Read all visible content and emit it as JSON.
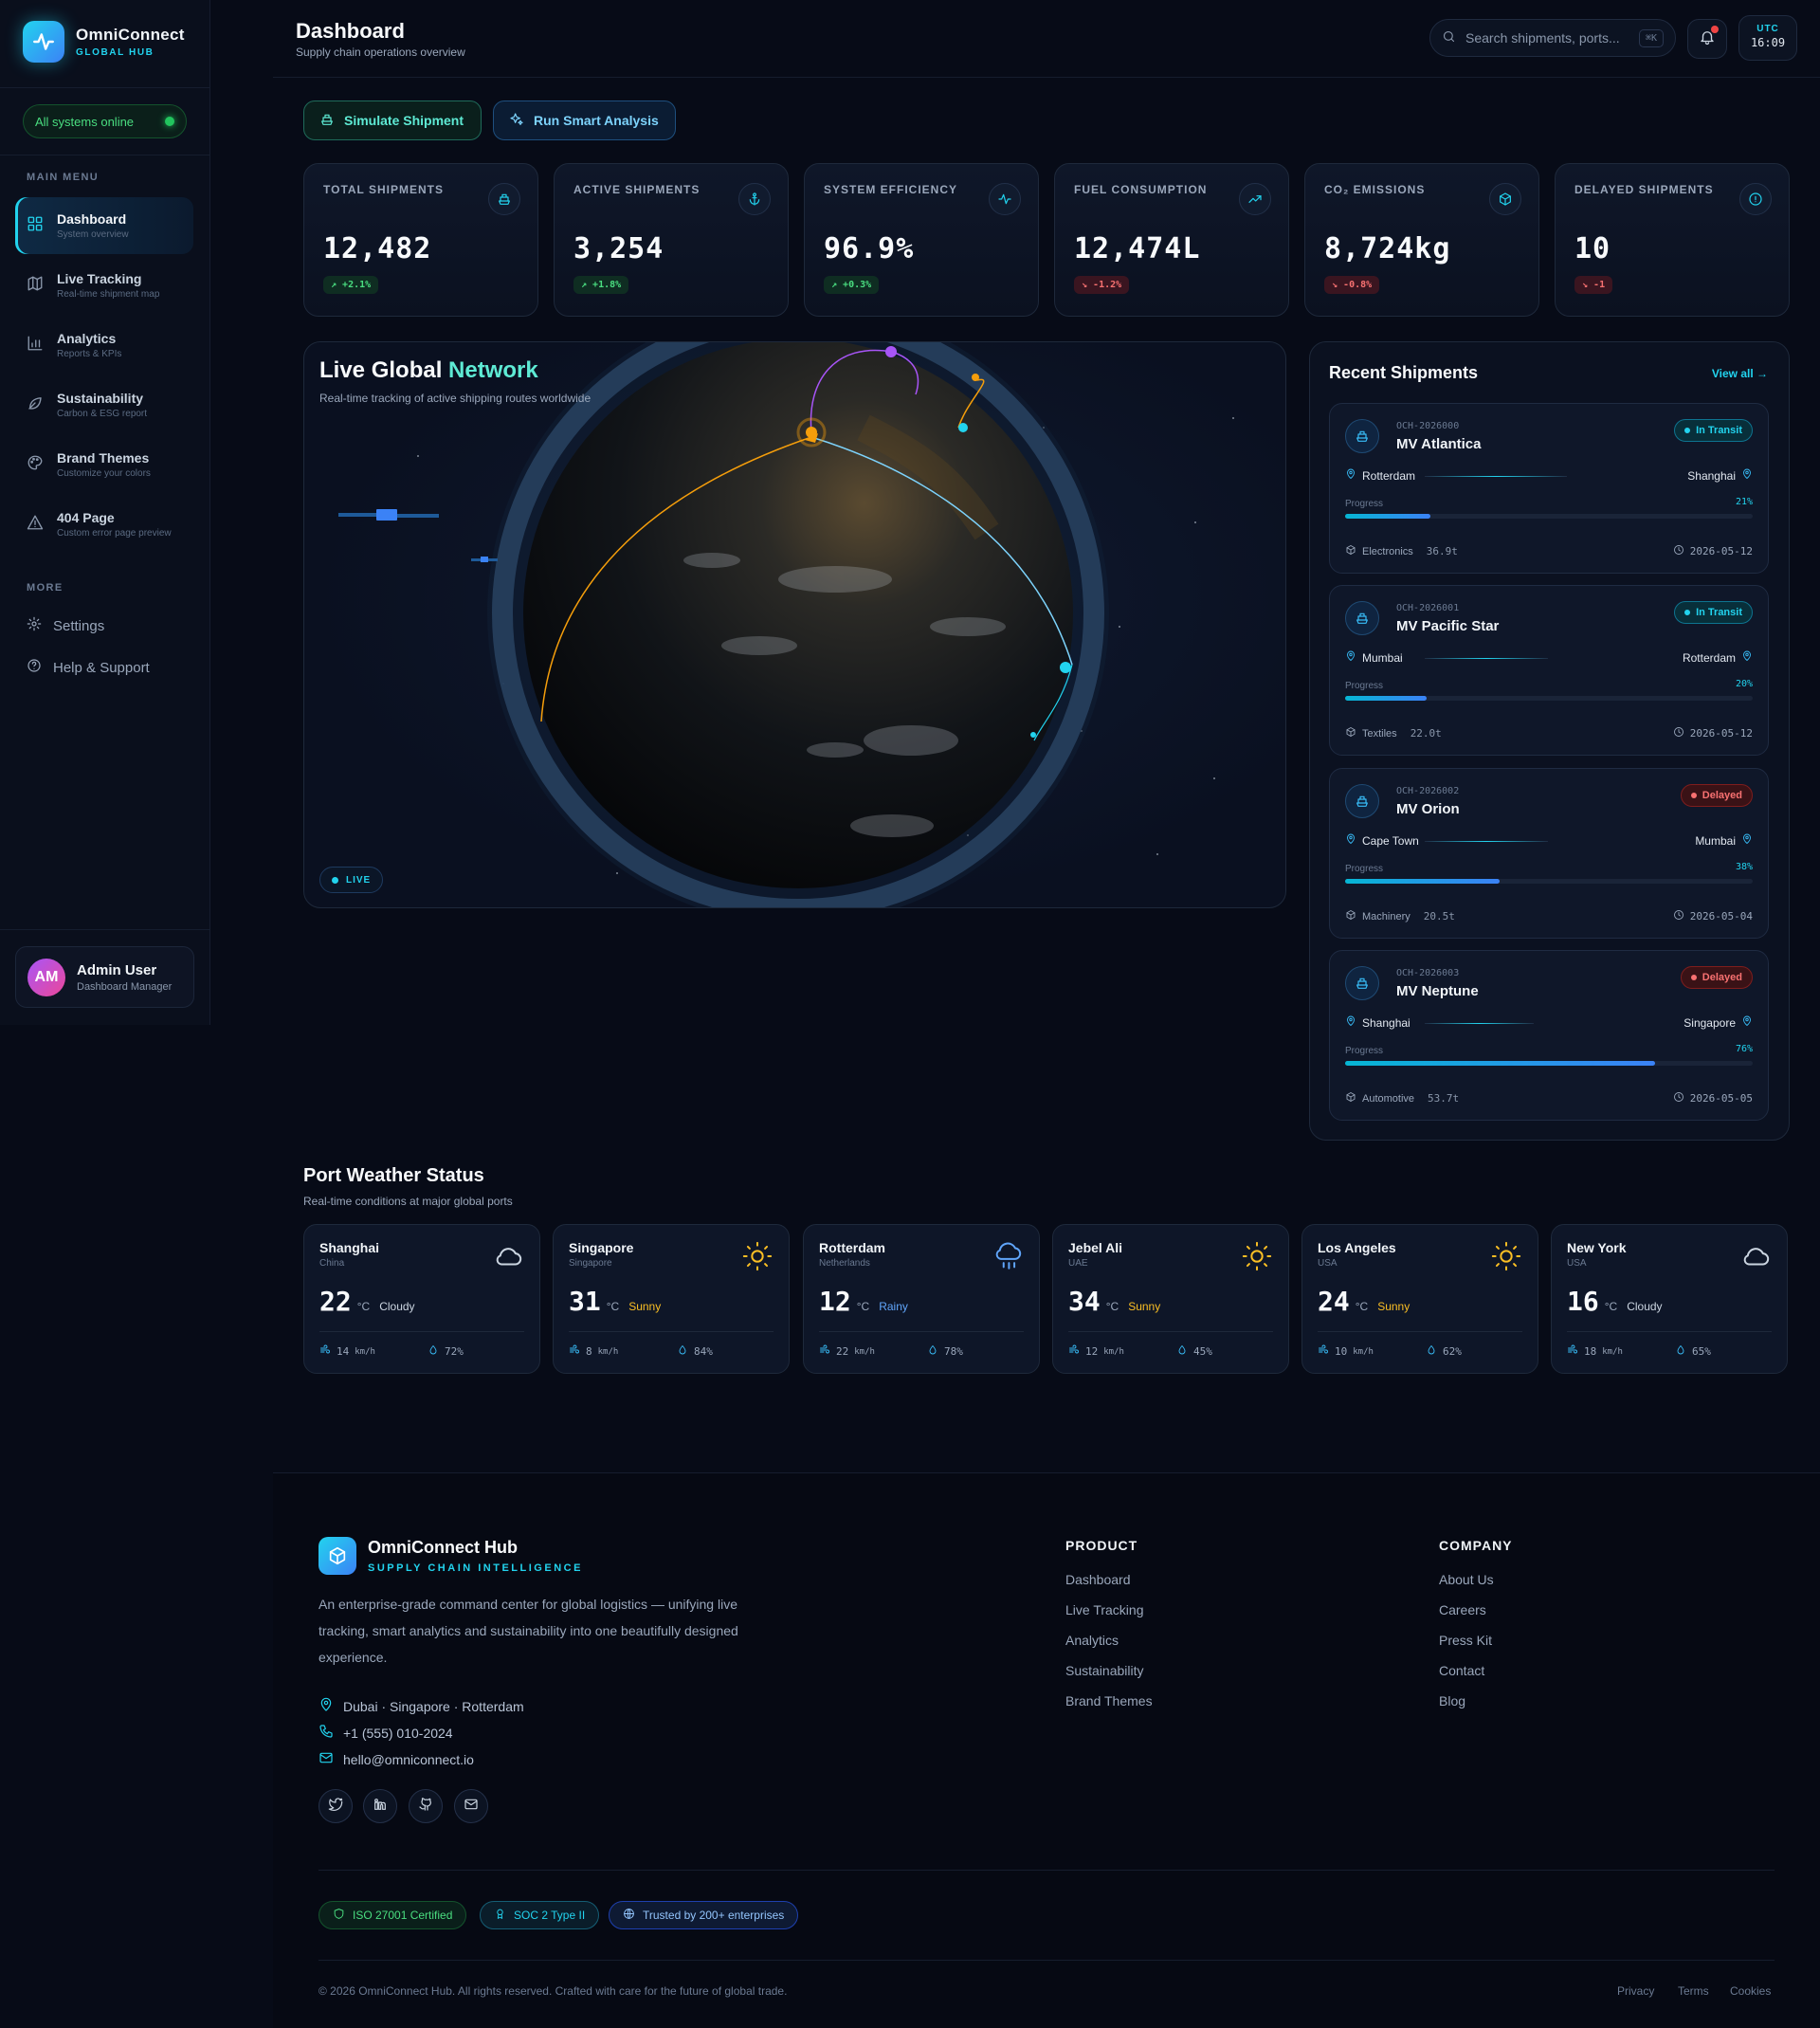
{
  "brand": {
    "name": "OmniConnect",
    "sub": "GLOBAL HUB",
    "status": "All systems online"
  },
  "sidebar": {
    "main_label": "MAIN MENU",
    "items": [
      {
        "label": "Dashboard",
        "sub": "System overview",
        "icon": "grid-icon"
      },
      {
        "label": "Live Tracking",
        "sub": "Real-time shipment map",
        "icon": "map-icon"
      },
      {
        "label": "Analytics",
        "sub": "Reports & KPIs",
        "icon": "bar-chart-icon"
      },
      {
        "label": "Sustainability",
        "sub": "Carbon & ESG report",
        "icon": "leaf-icon"
      },
      {
        "label": "Brand Themes",
        "sub": "Customize your colors",
        "icon": "palette-icon"
      },
      {
        "label": "404 Page",
        "sub": "Custom error page preview",
        "icon": "warning-icon"
      }
    ],
    "more_label": "MORE",
    "more": [
      {
        "label": "Settings",
        "icon": "gear-icon"
      },
      {
        "label": "Help & Support",
        "icon": "help-icon"
      }
    ],
    "user": {
      "initials": "AM",
      "name": "Admin User",
      "role": "Dashboard Manager"
    }
  },
  "header": {
    "title": "Dashboard",
    "subtitle": "Supply chain operations overview",
    "search_placeholder": "Search shipments, ports...",
    "search_kbd": "⌘K",
    "clock_zone": "UTC",
    "clock_time": "16:09"
  },
  "actions": {
    "simulate": "Simulate Shipment",
    "analyze": "Run Smart Analysis"
  },
  "kpis": [
    {
      "label": "TOTAL SHIPMENTS",
      "value": "12,482",
      "delta": "+2.1%",
      "trend": "up",
      "icon": "ship-icon"
    },
    {
      "label": "ACTIVE SHIPMENTS",
      "value": "3,254",
      "delta": "+1.8%",
      "trend": "up",
      "icon": "anchor-icon"
    },
    {
      "label": "SYSTEM EFFICIENCY",
      "value": "96.9%",
      "delta": "+0.3%",
      "trend": "up",
      "icon": "activity-icon"
    },
    {
      "label": "FUEL CONSUMPTION",
      "value": "12,474L",
      "delta": "-1.2%",
      "trend": "down",
      "icon": "trending-icon"
    },
    {
      "label": "CO₂ EMISSIONS",
      "value": "8,724kg",
      "delta": "-0.8%",
      "trend": "down",
      "icon": "cube-icon"
    },
    {
      "label": "DELAYED SHIPMENTS",
      "value": "10",
      "delta": "-1",
      "trend": "down",
      "icon": "alert-icon"
    }
  ],
  "globe": {
    "title_a": "Live Global",
    "title_b": "Network",
    "subtitle": "Real-time tracking of active shipping routes worldwide",
    "live": "LIVE"
  },
  "recent": {
    "title": "Recent Shipments",
    "view_all": "View all →",
    "progress_label": "Progress",
    "items": [
      {
        "id": "OCH-2026000",
        "name": "MV Atlantica",
        "status": "In Transit",
        "status_type": "transit",
        "from": "Rotterdam",
        "to": "Shanghai",
        "progress": 21,
        "progress_text": "21%",
        "cargo": "Electronics",
        "weight": "36.9t",
        "eta": "2026-05-12"
      },
      {
        "id": "OCH-2026001",
        "name": "MV Pacific Star",
        "status": "In Transit",
        "status_type": "transit",
        "from": "Mumbai",
        "to": "Rotterdam",
        "progress": 20,
        "progress_text": "20%",
        "cargo": "Textiles",
        "weight": "22.0t",
        "eta": "2026-05-12"
      },
      {
        "id": "OCH-2026002",
        "name": "MV Orion",
        "status": "Delayed",
        "status_type": "delayed",
        "from": "Cape Town",
        "to": "Mumbai",
        "progress": 38,
        "progress_text": "38%",
        "cargo": "Machinery",
        "weight": "20.5t",
        "eta": "2026-05-04"
      },
      {
        "id": "OCH-2026003",
        "name": "MV Neptune",
        "status": "Delayed",
        "status_type": "delayed",
        "from": "Shanghai",
        "to": "Singapore",
        "progress": 76,
        "progress_text": "76%",
        "cargo": "Automotive",
        "weight": "53.7t",
        "eta": "2026-05-05"
      }
    ]
  },
  "weather": {
    "title": "Port Weather Status",
    "subtitle": "Real-time conditions at major global ports",
    "wind_unit": "km/h",
    "temp_unit": "°C",
    "ports": [
      {
        "city": "Shanghai",
        "country": "China",
        "temp": "22",
        "cond": "Cloudy",
        "wind": "14",
        "hum": "72%",
        "icon": "cloud-icon",
        "color": "#cbd5e1"
      },
      {
        "city": "Singapore",
        "country": "Singapore",
        "temp": "31",
        "cond": "Sunny",
        "wind": "8",
        "hum": "84%",
        "icon": "sun-icon",
        "color": "#fbbf24"
      },
      {
        "city": "Rotterdam",
        "country": "Netherlands",
        "temp": "12",
        "cond": "Rainy",
        "wind": "22",
        "hum": "78%",
        "icon": "rain-icon",
        "color": "#60a5fa"
      },
      {
        "city": "Jebel Ali",
        "country": "UAE",
        "temp": "34",
        "cond": "Sunny",
        "wind": "12",
        "hum": "45%",
        "icon": "sun-icon",
        "color": "#fbbf24"
      },
      {
        "city": "Los Angeles",
        "country": "USA",
        "temp": "24",
        "cond": "Sunny",
        "wind": "10",
        "hum": "62%",
        "icon": "sun-icon",
        "color": "#fbbf24"
      },
      {
        "city": "New York",
        "country": "USA",
        "temp": "16",
        "cond": "Cloudy",
        "wind": "18",
        "hum": "65%",
        "icon": "cloud-icon",
        "color": "#cbd5e1"
      }
    ]
  },
  "footer": {
    "name": "OmniConnect Hub",
    "tagline": "SUPPLY CHAIN INTELLIGENCE",
    "desc": "An enterprise-grade command center for global logistics — unifying live tracking, smart analytics and sustainability into one beautifully designed experience.",
    "location": "Dubai · Singapore · Rotterdam",
    "phone": "+1 (555) 010-2024",
    "email": "hello@omniconnect.io",
    "product_h": "PRODUCT",
    "product": [
      "Dashboard",
      "Live Tracking",
      "Analytics",
      "Sustainability",
      "Brand Themes"
    ],
    "company_h": "COMPANY",
    "company": [
      "About Us",
      "Careers",
      "Press Kit",
      "Contact",
      "Blog"
    ],
    "certs": [
      "ISO 27001 Certified",
      "SOC 2 Type II",
      "Trusted by 200+ enterprises"
    ],
    "copyright": "© 2026 OmniConnect Hub. All rights reserved. Crafted with care for the future of global trade.",
    "legal": [
      "Privacy",
      "Terms",
      "Cookies"
    ]
  },
  "colors": {
    "accent": "#22d3ee",
    "success": "#4ade80",
    "danger": "#f87171",
    "background": "#070b17"
  }
}
